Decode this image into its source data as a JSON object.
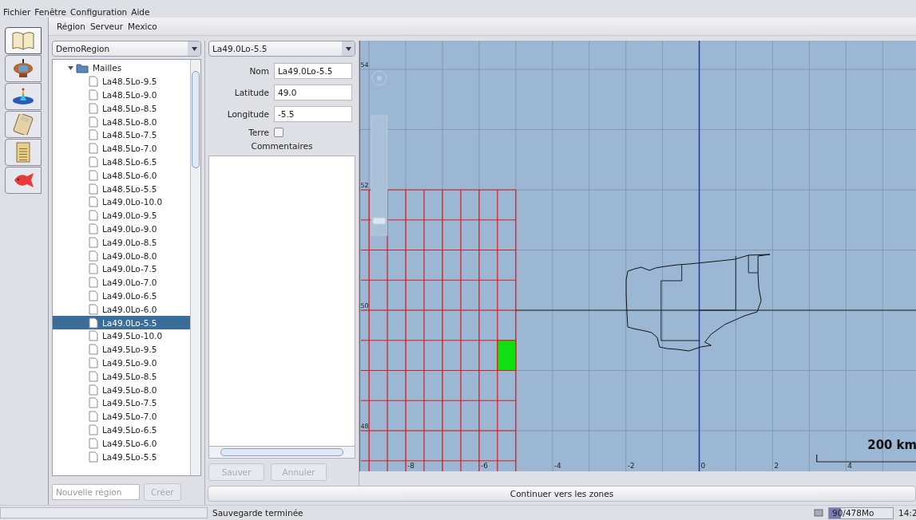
{
  "menu": [
    "Fichier",
    "Fenêtre",
    "Configuration",
    "Aide"
  ],
  "tools": [
    {
      "kind": "book",
      "selected": true
    },
    {
      "kind": "figure",
      "selected": false
    },
    {
      "kind": "plot",
      "selected": false
    },
    {
      "kind": "calculator",
      "selected": false
    },
    {
      "kind": "document",
      "selected": false
    },
    {
      "kind": "fish",
      "selected": false
    }
  ],
  "submenu": [
    "Région",
    "Serveur",
    "Mexico"
  ],
  "region_select": {
    "value": "DemoRegion"
  },
  "tree": {
    "label": "Mailles",
    "expanded": true,
    "children": [
      {
        "label": "La48.5Lo-9.5",
        "selected": false
      },
      {
        "label": "La48.5Lo-9.0",
        "selected": false
      },
      {
        "label": "La48.5Lo-8.5",
        "selected": false
      },
      {
        "label": "La48.5Lo-8.0",
        "selected": false
      },
      {
        "label": "La48.5Lo-7.5",
        "selected": false
      },
      {
        "label": "La48.5Lo-7.0",
        "selected": false
      },
      {
        "label": "La48.5Lo-6.5",
        "selected": false
      },
      {
        "label": "La48.5Lo-6.0",
        "selected": false
      },
      {
        "label": "La48.5Lo-5.5",
        "selected": false
      },
      {
        "label": "La49.0Lo-10.0",
        "selected": false
      },
      {
        "label": "La49.0Lo-9.5",
        "selected": false
      },
      {
        "label": "La49.0Lo-9.0",
        "selected": false
      },
      {
        "label": "La49.0Lo-8.5",
        "selected": false
      },
      {
        "label": "La49.0Lo-8.0",
        "selected": false
      },
      {
        "label": "La49.0Lo-7.5",
        "selected": false
      },
      {
        "label": "La49.0Lo-7.0",
        "selected": false
      },
      {
        "label": "La49.0Lo-6.5",
        "selected": false
      },
      {
        "label": "La49.0Lo-6.0",
        "selected": false
      },
      {
        "label": "La49.0Lo-5.5",
        "selected": true
      },
      {
        "label": "La49.5Lo-10.0",
        "selected": false
      },
      {
        "label": "La49.5Lo-9.5",
        "selected": false
      },
      {
        "label": "La49.5Lo-9.0",
        "selected": false
      },
      {
        "label": "La49.5Lo-8.5",
        "selected": false
      },
      {
        "label": "La49.5Lo-8.0",
        "selected": false
      },
      {
        "label": "La49.5Lo-7.5",
        "selected": false
      },
      {
        "label": "La49.5Lo-7.0",
        "selected": false
      },
      {
        "label": "La49.5Lo-6.5",
        "selected": false
      },
      {
        "label": "La49.5Lo-6.0",
        "selected": false
      },
      {
        "label": "La49.5Lo-5.5",
        "selected": false
      }
    ]
  },
  "new_region": {
    "placeholder": "Nouvelle région",
    "button": "Créer",
    "button_disabled": true
  },
  "mesh_select": {
    "value": "La49.0Lo-5.5"
  },
  "form": {
    "fields": [
      {
        "label": "Nom",
        "value": "La49.0Lo-5.5"
      },
      {
        "label": "Latitude",
        "value": "49.0"
      },
      {
        "label": "Longitude",
        "value": "-5.5"
      }
    ],
    "land": {
      "label": "Terre",
      "checked": false
    },
    "comments_label": "Commentaires"
  },
  "buttons": [
    {
      "label": "Sauver",
      "disabled": true
    },
    {
      "label": "Annuler",
      "disabled": true
    }
  ],
  "map": {
    "lat_labels": [
      "54",
      "52",
      "50",
      "48"
    ],
    "lon_labels": [
      "-8",
      "-6",
      "-4",
      "-2",
      "0",
      "2",
      "4"
    ],
    "scale": "200 km",
    "zoom_slider": {
      "level": 0.1
    }
  },
  "continue_button": "Continuer vers les zones",
  "status": {
    "message": "Sauvegarde terminée",
    "memory": {
      "label": "90/478Mo",
      "level": 0.19
    },
    "time": "14:2"
  }
}
